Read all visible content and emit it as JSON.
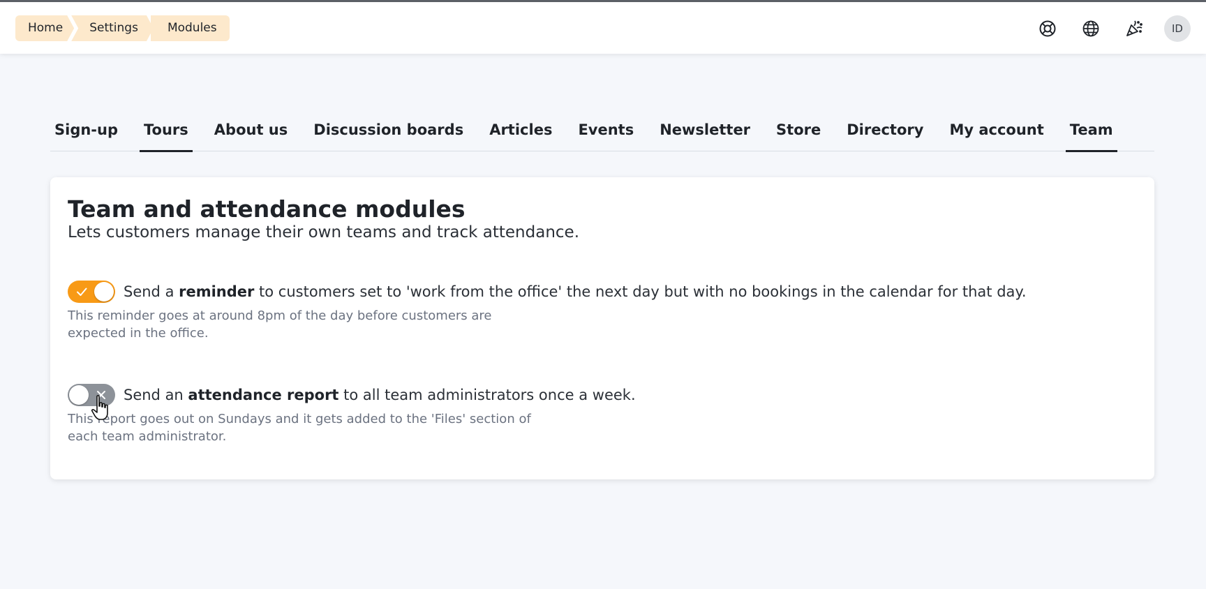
{
  "breadcrumb": [
    {
      "label": "Home"
    },
    {
      "label": "Settings"
    },
    {
      "label": "Modules"
    }
  ],
  "header": {
    "icons": [
      "lifebuoy-icon",
      "globe-icon",
      "party-popper-icon"
    ],
    "avatar_initials": "ID"
  },
  "tabs": [
    {
      "label": "Sign-up",
      "active": false
    },
    {
      "label": "Tours",
      "active": true
    },
    {
      "label": "About us",
      "active": false
    },
    {
      "label": "Discussion boards",
      "active": false
    },
    {
      "label": "Articles",
      "active": false
    },
    {
      "label": "Events",
      "active": false
    },
    {
      "label": "Newsletter",
      "active": false
    },
    {
      "label": "Store",
      "active": false
    },
    {
      "label": "Directory",
      "active": false
    },
    {
      "label": "My account",
      "active": false
    },
    {
      "label": "Team",
      "active": true
    }
  ],
  "card": {
    "title": "Team and attendance modules",
    "subtitle": "Lets customers manage their own teams and track attendance."
  },
  "settings": [
    {
      "enabled": true,
      "text_before": "Send a ",
      "text_bold": "reminder",
      "text_after": " to customers set to 'work from the office' the next day but with no bookings in the calendar for that day.",
      "description": "This reminder goes at around 8pm of the day before customers are expected in the office."
    },
    {
      "enabled": false,
      "text_before": "Send an ",
      "text_bold": "attendance report",
      "text_after": " to all team administrators once a week.",
      "description": "This report goes out on Sundays and it gets added to the 'Files' section of each team administrator."
    }
  ],
  "colors": {
    "accent": "#f89a16",
    "breadcrumb_bg": "#fde9cc",
    "toggle_off": "#8d9299",
    "page_bg": "#f5f7fb"
  }
}
